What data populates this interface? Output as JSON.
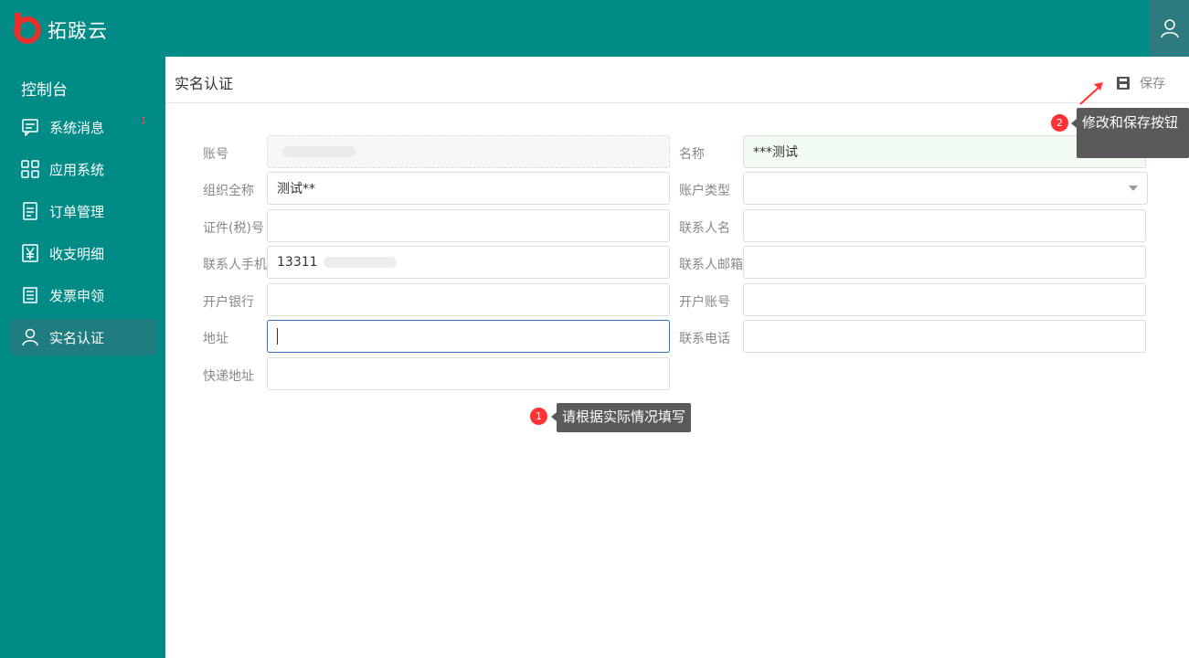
{
  "brand": {
    "name": "拓跋云"
  },
  "sidebar": {
    "console": "控制台",
    "badge": "1",
    "items": [
      {
        "label": "系统消息",
        "icon": "message-icon"
      },
      {
        "label": "应用系统",
        "icon": "grid-icon"
      },
      {
        "label": "订单管理",
        "icon": "order-icon"
      },
      {
        "label": "收支明细",
        "icon": "yen-icon"
      },
      {
        "label": "发票申领",
        "icon": "invoice-icon"
      },
      {
        "label": "实名认证",
        "icon": "user-icon",
        "active": true
      }
    ]
  },
  "header": {
    "title": "实名认证",
    "save_label": "保存"
  },
  "form": {
    "account_label": "账号",
    "account_value": "",
    "name_label": "名称",
    "name_value": "***测试",
    "org_label": "组织全称",
    "org_value": "测试**",
    "acct_type_label": "账户类型",
    "acct_type_value": "",
    "cert_label": "证件(税)号",
    "cert_value": "",
    "contact_name_label": "联系人名",
    "contact_name_value": "",
    "contact_phone_label": "联系人手机",
    "contact_phone_value": "13311",
    "contact_email_label": "联系人邮箱",
    "contact_email_value": "",
    "bank_label": "开户银行",
    "bank_value": "",
    "bank_acct_label": "开户账号",
    "bank_acct_value": "",
    "address_label": "地址",
    "address_value": "",
    "tel_label": "联系电话",
    "tel_value": "",
    "express_label": "快递地址",
    "express_value": ""
  },
  "tips": {
    "tip1_num": "1",
    "tip1_text": "请根据实际情况填写",
    "tip2_num": "2",
    "tip2_text": "修改和保存按钮"
  },
  "colors": {
    "primary": "#008b87",
    "active": "#1f7d80",
    "badge": "#ff3333"
  }
}
